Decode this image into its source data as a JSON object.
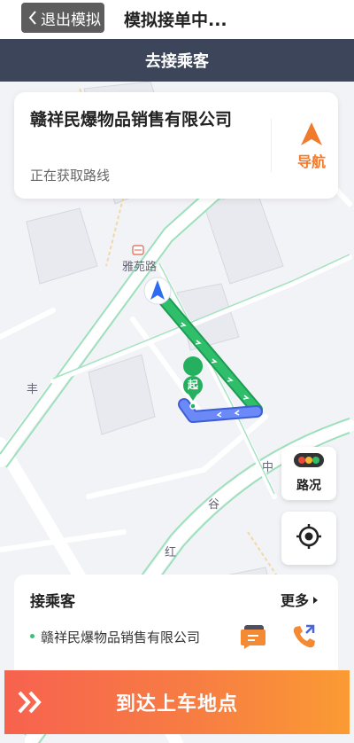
{
  "top_bar": {
    "back_label": "退出模拟",
    "title": "模拟接单中..."
  },
  "status_bar": {
    "text": "去接乘客"
  },
  "destination_card": {
    "name": "赣祥民爆物品销售有限公司",
    "status": "正在获取路线",
    "nav_label": "导航"
  },
  "map": {
    "poi_label": "雅苑路",
    "start_marker": "起",
    "road_chars": [
      "中",
      "谷",
      "红",
      "丰"
    ]
  },
  "traffic_button": {
    "label": "路况"
  },
  "passenger_panel": {
    "title": "接乘客",
    "more_label": "更多",
    "address": "赣祥民爆物品销售有限公司"
  },
  "action_button": {
    "label": "到达上车地点"
  },
  "colors": {
    "accent_orange": "#f07a2d",
    "route_green": "#2fbf6b",
    "route_blue": "#5b7cf7",
    "header_dark": "#3c455a"
  }
}
